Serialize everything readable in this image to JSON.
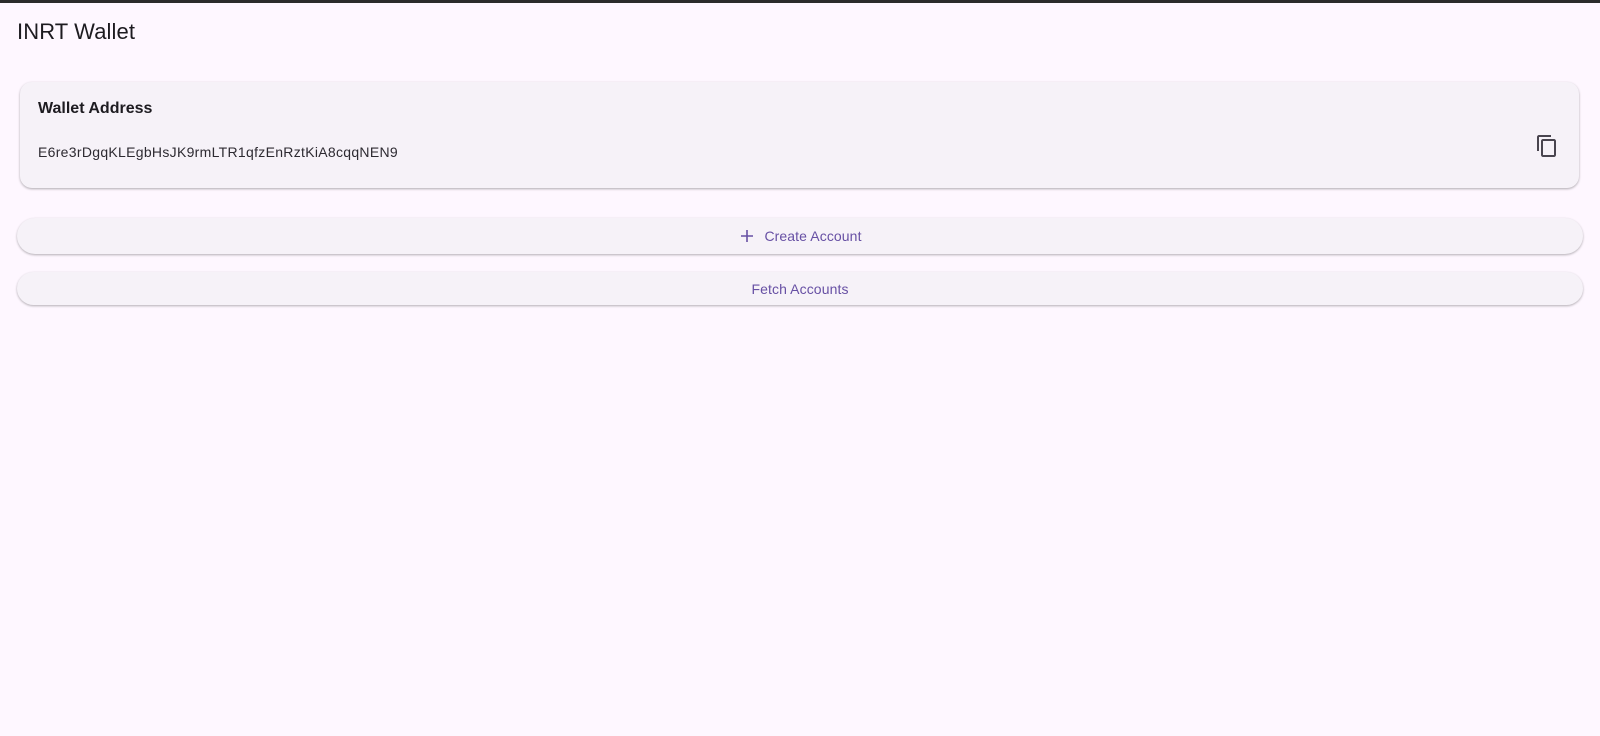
{
  "app": {
    "title": "INRT Wallet"
  },
  "wallet_card": {
    "title": "Wallet Address",
    "address": "E6re3rDgqKLEgbHsJK9rmLTR1qfzEnRztKiA8cqqNEN9",
    "copy_icon": "copy-icon"
  },
  "actions": {
    "create_label": "Create Account",
    "create_icon": "plus-icon",
    "fetch_label": "Fetch Accounts"
  },
  "colors": {
    "background": "#fef7ff",
    "surface": "#f6f2f8",
    "accent": "#6750a4",
    "text": "#1d1b20"
  }
}
